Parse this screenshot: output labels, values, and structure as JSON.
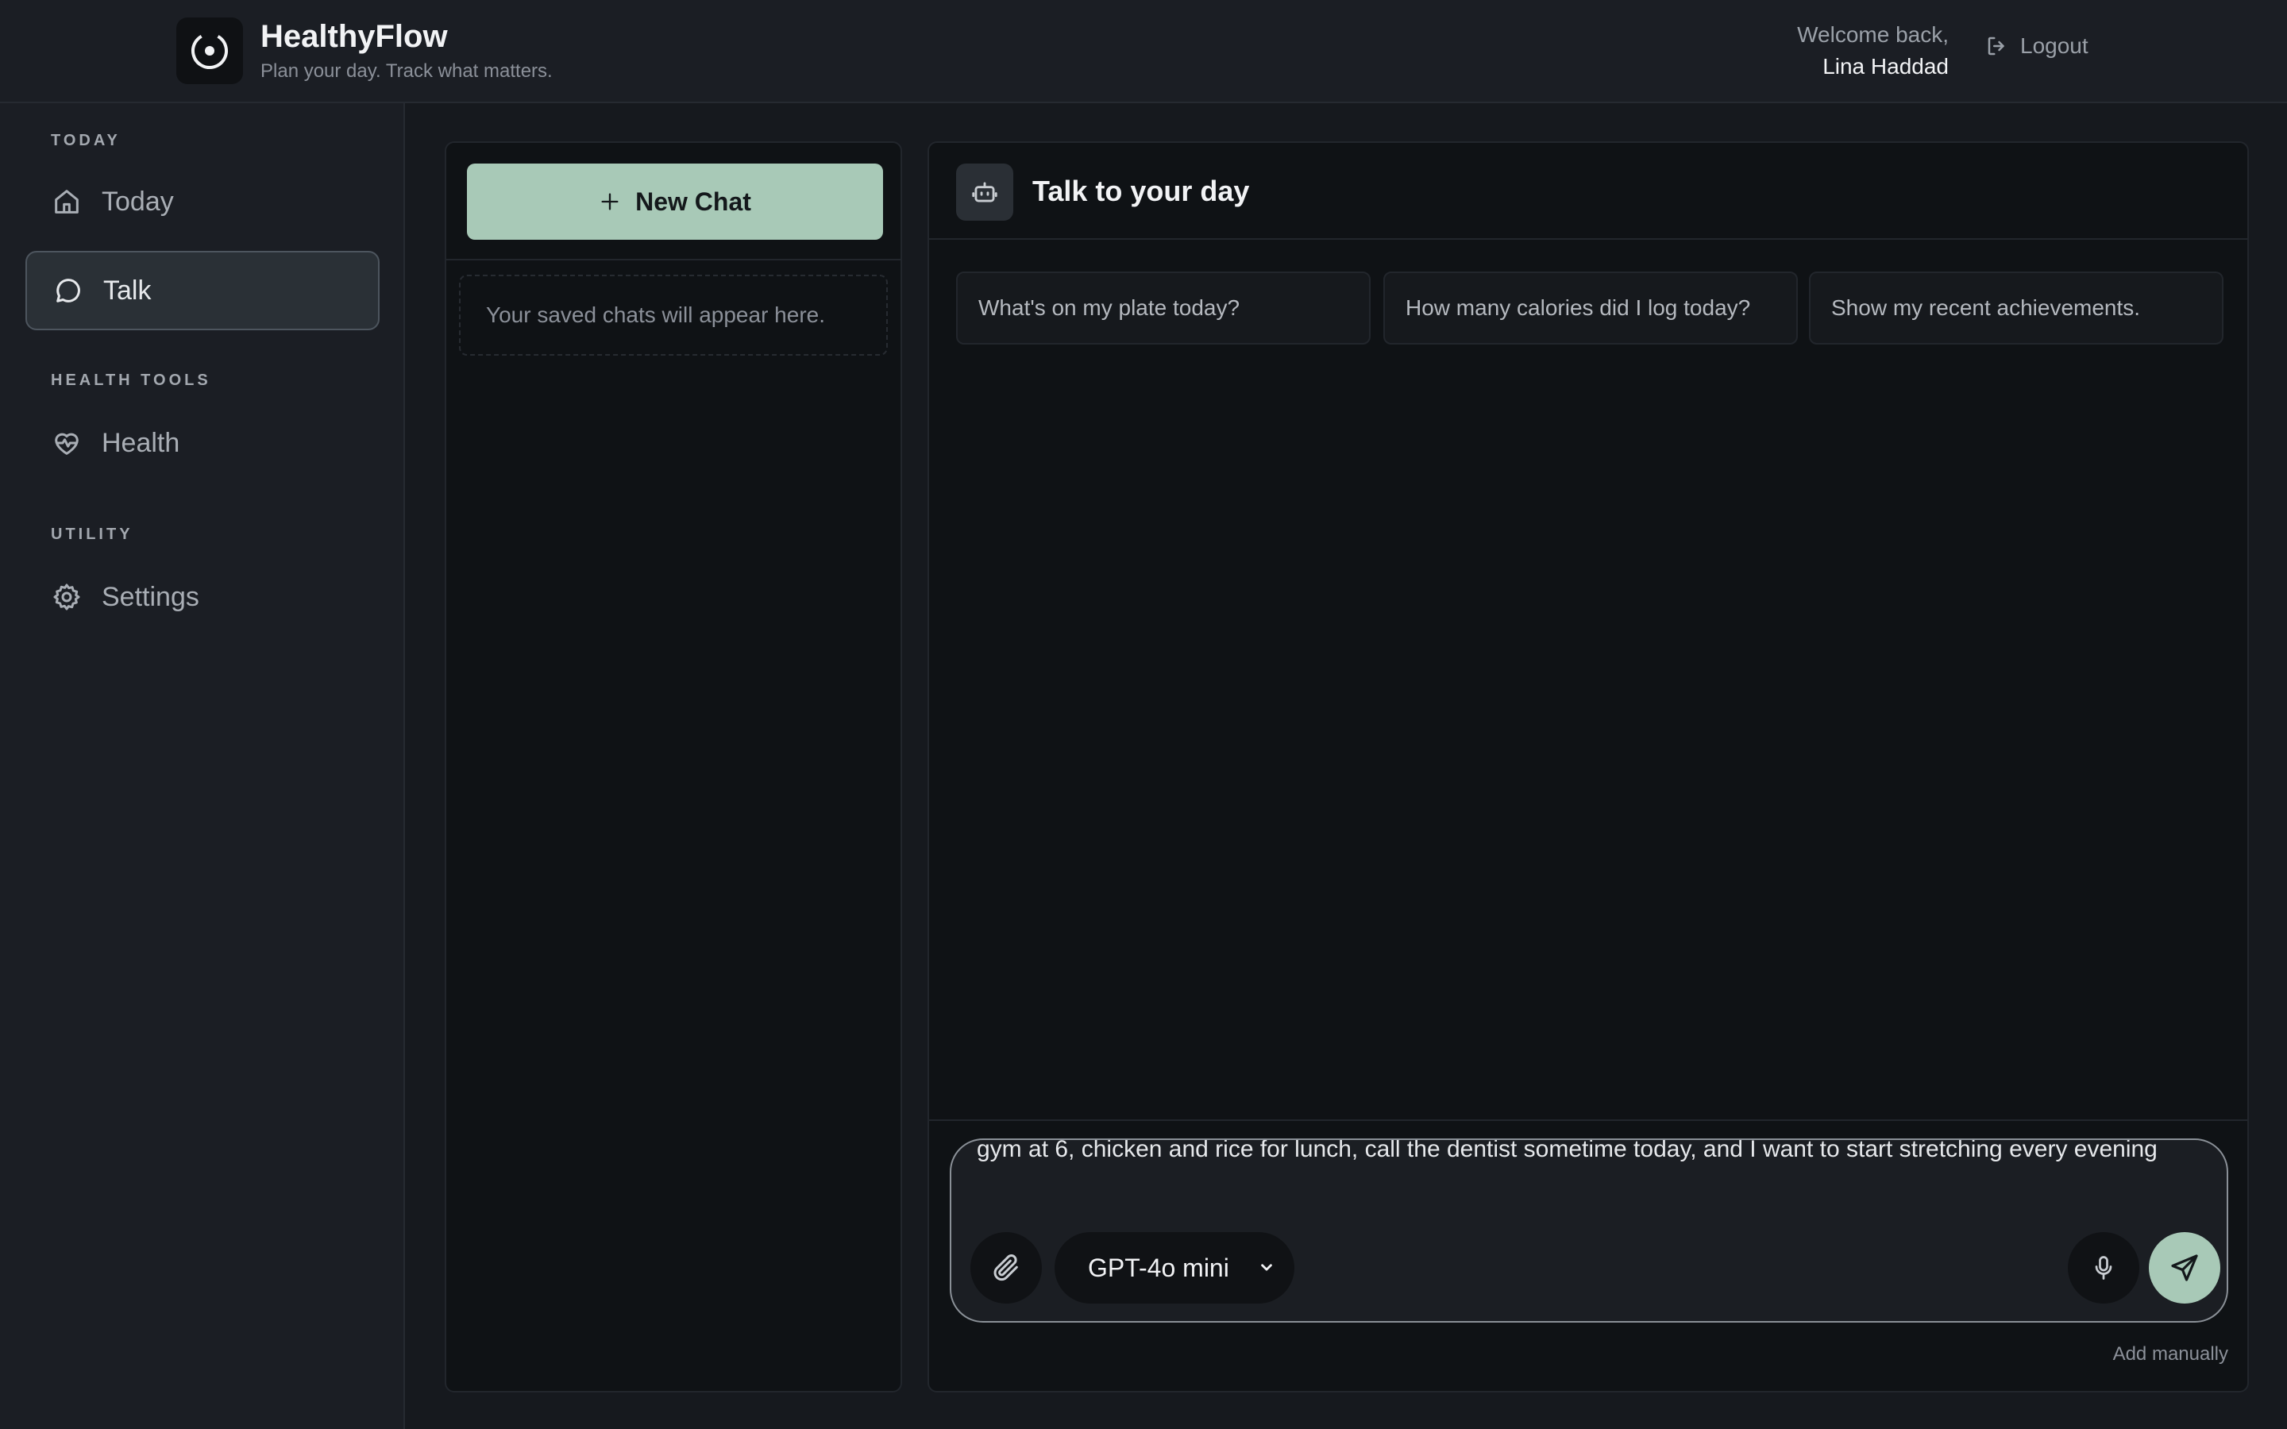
{
  "header": {
    "app_name": "HealthyFlow",
    "tagline": "Plan your day. Track what matters.",
    "welcome_text": "Welcome back,",
    "user_name": "Lina Haddad",
    "logout_label": "Logout"
  },
  "sidebar": {
    "sections": [
      {
        "label": "TODAY"
      },
      {
        "label": "HEALTH TOOLS"
      },
      {
        "label": "UTILITY"
      }
    ],
    "items": [
      {
        "label": "Today",
        "icon": "home-icon"
      },
      {
        "label": "Talk",
        "icon": "chat-bubble-icon",
        "active": true
      },
      {
        "label": "Health",
        "icon": "heart-pulse-icon"
      },
      {
        "label": "Settings",
        "icon": "gear-icon"
      }
    ]
  },
  "chat_list": {
    "new_chat_label": "New Chat",
    "empty_text": "Your saved chats will appear here."
  },
  "chat": {
    "title": "Talk to your day",
    "suggestions": [
      "What's on my plate today?",
      "How many calories did I log today?",
      "Show my recent achievements."
    ],
    "composer_value": "gym at 6, chicken and rice for lunch, call the dentist sometime today, and I want to start stretching every evening",
    "model": "GPT-4o mini",
    "add_manually_label": "Add manually"
  },
  "colors": {
    "accent": "#a8c9b7",
    "background": "#16191e",
    "panel": "#0f1215",
    "sidebar": "#1b1e24"
  }
}
